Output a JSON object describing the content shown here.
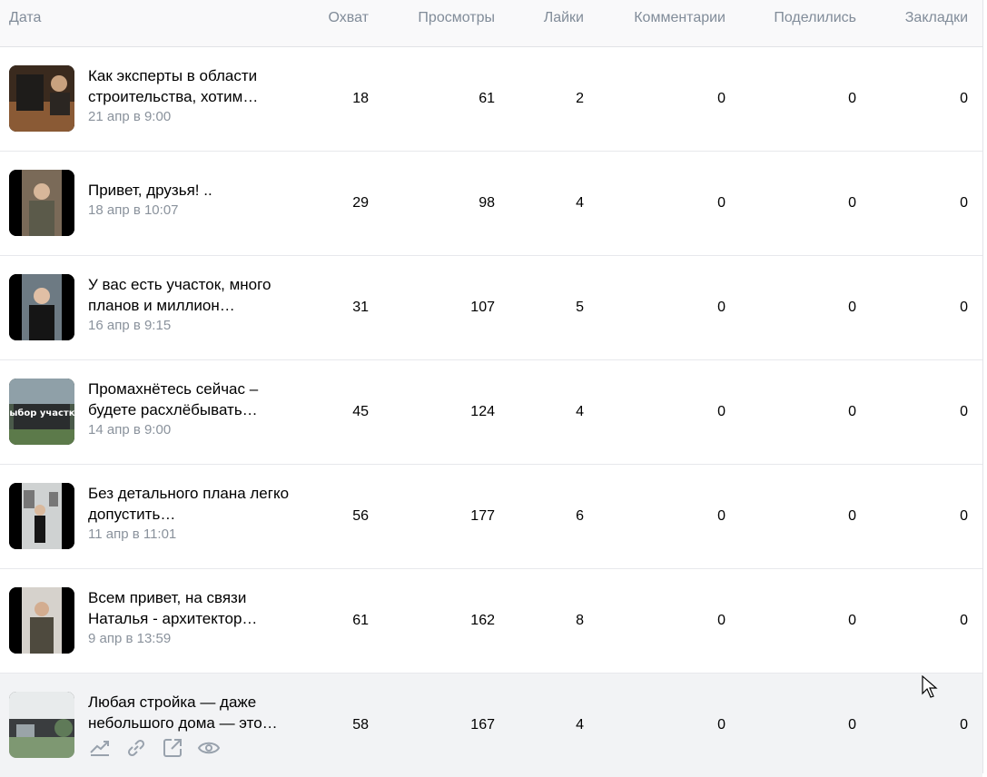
{
  "columns": {
    "date": "Дата",
    "reach": "Охват",
    "views": "Просмотры",
    "likes": "Лайки",
    "comments": "Комментарии",
    "shares": "Поделились",
    "bookmarks": "Закладки"
  },
  "rows": [
    {
      "title": "Как эксперты в области строительства, хотим…",
      "date": "21 апр в 9:00",
      "reach": "18",
      "views": "61",
      "likes": "2",
      "comments": "0",
      "shares": "0",
      "bookmarks": "0"
    },
    {
      "title": "Привет, друзья!   ..",
      "date": "18 апр в 10:07",
      "reach": "29",
      "views": "98",
      "likes": "4",
      "comments": "0",
      "shares": "0",
      "bookmarks": "0"
    },
    {
      "title": "У вас есть участок, много планов и миллион…",
      "date": "16 апр в 9:15",
      "reach": "31",
      "views": "107",
      "likes": "5",
      "comments": "0",
      "shares": "0",
      "bookmarks": "0"
    },
    {
      "title": "Промахнётесь сейчас – будете расхлёбывать…",
      "date": "14 апр в 9:00",
      "reach": "45",
      "views": "124",
      "likes": "4",
      "comments": "0",
      "shares": "0",
      "bookmarks": "0",
      "thumb_text": "Выбор участка"
    },
    {
      "title": "Без детального плана легко допустить…",
      "date": "11 апр в 11:01",
      "reach": "56",
      "views": "177",
      "likes": "6",
      "comments": "0",
      "shares": "0",
      "bookmarks": "0"
    },
    {
      "title": "Всем привет, на связи Наталья - архитектор…",
      "date": "9 апр в 13:59",
      "reach": "61",
      "views": "162",
      "likes": "8",
      "comments": "0",
      "shares": "0",
      "bookmarks": "0"
    },
    {
      "title": "Любая стройка — даже небольшого дома — это…",
      "reach": "58",
      "views": "167",
      "likes": "4",
      "comments": "0",
      "shares": "0",
      "bookmarks": "0"
    }
  ],
  "row_actions": [
    "stats-icon",
    "link-icon",
    "share-icon",
    "eye-icon"
  ],
  "colors": {
    "header_bg": "#f9f9fa",
    "muted": "#818c99",
    "hover_row": "#f2f3f5",
    "icon": "#99a2ad"
  }
}
